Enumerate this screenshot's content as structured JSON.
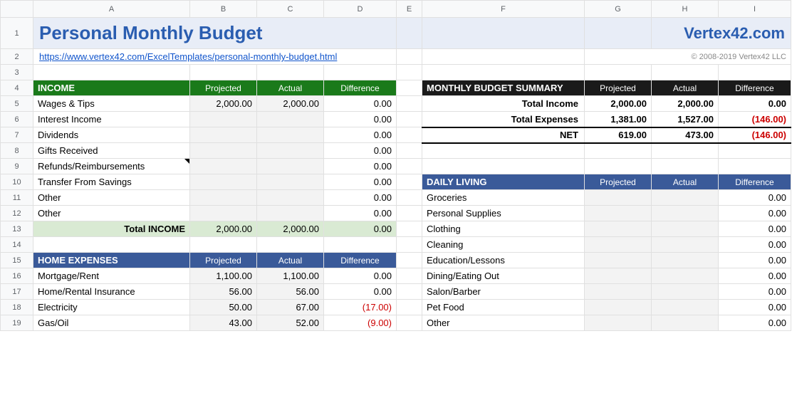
{
  "cols": [
    "A",
    "B",
    "C",
    "D",
    "E",
    "F",
    "G",
    "H",
    "I"
  ],
  "title": "Personal Monthly Budget",
  "brand": "Vertex42.com",
  "link": "https://www.vertex42.com/ExcelTemplates/personal-monthly-budget.html",
  "copyright": "© 2008-2019 Vertex42 LLC",
  "hdr": {
    "proj": "Projected",
    "act": "Actual",
    "diff": "Difference"
  },
  "income": {
    "title": "INCOME",
    "rows": [
      {
        "label": "Wages & Tips",
        "proj": "2,000.00",
        "act": "2,000.00",
        "diff": "0.00"
      },
      {
        "label": "Interest Income",
        "proj": "",
        "act": "",
        "diff": "0.00"
      },
      {
        "label": "Dividends",
        "proj": "",
        "act": "",
        "diff": "0.00"
      },
      {
        "label": "Gifts Received",
        "proj": "",
        "act": "",
        "diff": "0.00"
      },
      {
        "label": "Refunds/Reimbursements",
        "proj": "",
        "act": "",
        "diff": "0.00"
      },
      {
        "label": "Transfer From Savings",
        "proj": "",
        "act": "",
        "diff": "0.00"
      },
      {
        "label": "Other",
        "proj": "",
        "act": "",
        "diff": "0.00"
      },
      {
        "label": "Other",
        "proj": "",
        "act": "",
        "diff": "0.00"
      }
    ],
    "total": {
      "label": "Total INCOME",
      "proj": "2,000.00",
      "act": "2,000.00",
      "diff": "0.00"
    }
  },
  "summary": {
    "title": "MONTHLY BUDGET SUMMARY",
    "rows": [
      {
        "label": "Total Income",
        "proj": "2,000.00",
        "act": "2,000.00",
        "diff": "0.00",
        "neg": false
      },
      {
        "label": "Total Expenses",
        "proj": "1,381.00",
        "act": "1,527.00",
        "diff": "(146.00)",
        "neg": true
      },
      {
        "label": "NET",
        "proj": "619.00",
        "act": "473.00",
        "diff": "(146.00)",
        "neg": true
      }
    ]
  },
  "home": {
    "title": "HOME EXPENSES",
    "rows": [
      {
        "label": "Mortgage/Rent",
        "proj": "1,100.00",
        "act": "1,100.00",
        "diff": "0.00",
        "neg": false
      },
      {
        "label": "Home/Rental Insurance",
        "proj": "56.00",
        "act": "56.00",
        "diff": "0.00",
        "neg": false
      },
      {
        "label": "Electricity",
        "proj": "50.00",
        "act": "67.00",
        "diff": "(17.00)",
        "neg": true
      },
      {
        "label": "Gas/Oil",
        "proj": "43.00",
        "act": "52.00",
        "diff": "(9.00)",
        "neg": true
      }
    ]
  },
  "daily": {
    "title": "DAILY LIVING",
    "rows": [
      {
        "label": "Groceries",
        "diff": "0.00"
      },
      {
        "label": "Personal Supplies",
        "diff": "0.00"
      },
      {
        "label": "Clothing",
        "diff": "0.00"
      },
      {
        "label": "Cleaning",
        "diff": "0.00"
      },
      {
        "label": "Education/Lessons",
        "diff": "0.00"
      },
      {
        "label": "Dining/Eating Out",
        "diff": "0.00"
      },
      {
        "label": "Salon/Barber",
        "diff": "0.00"
      },
      {
        "label": "Pet Food",
        "diff": "0.00"
      },
      {
        "label": "Other",
        "diff": "0.00"
      }
    ]
  },
  "rownums": [
    "1",
    "2",
    "3",
    "4",
    "5",
    "6",
    "7",
    "8",
    "9",
    "10",
    "11",
    "12",
    "13",
    "14",
    "15",
    "16",
    "17",
    "18",
    "19"
  ]
}
